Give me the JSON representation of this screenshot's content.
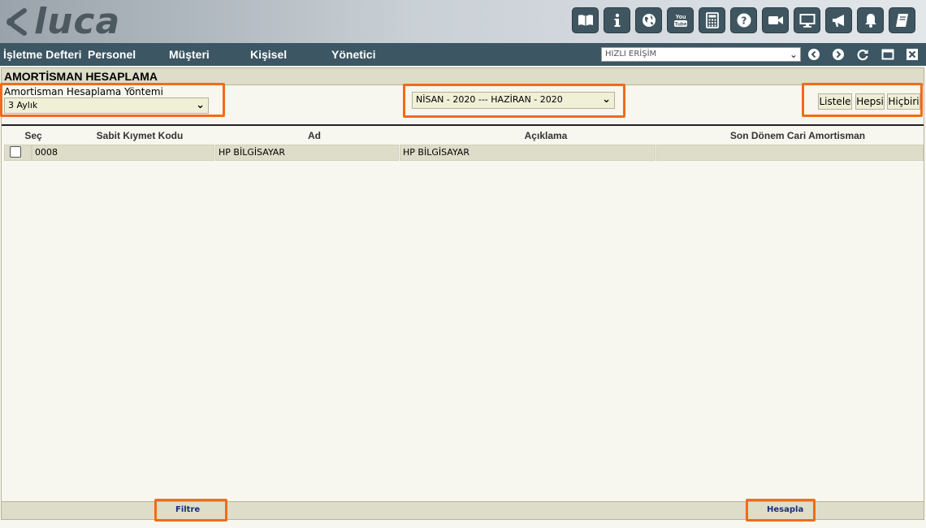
{
  "app": {
    "logo_text": "luca"
  },
  "header_icons": [
    {
      "name": "book-open-icon"
    },
    {
      "name": "info-icon"
    },
    {
      "name": "globe-icon"
    },
    {
      "name": "youtube-icon",
      "text": "You\nTube"
    },
    {
      "name": "calculator-icon"
    },
    {
      "name": "help-icon"
    },
    {
      "name": "video-camera-icon"
    },
    {
      "name": "monitor-icon"
    },
    {
      "name": "megaphone-icon"
    },
    {
      "name": "bell-icon"
    },
    {
      "name": "notebook-icon"
    }
  ],
  "nav": {
    "items": [
      "İşletme Defteri",
      "Personel",
      "Müşteri",
      "Kişisel",
      "Yönetici"
    ],
    "quick_access": "HIZLI ERİŞİM"
  },
  "panel": {
    "title": "AMORTİSMAN HESAPLAMA",
    "method_label": "Amortisman Hesaplama Yöntemi",
    "method_value": "3 Aylık",
    "period_value": "NİSAN - 2020 --- HAZİRAN - 2020",
    "buttons": {
      "list": "Listele",
      "all": "Hepsi",
      "none": "Hiçbiri"
    }
  },
  "table": {
    "headers": [
      "Seç",
      "Sabit Kıymet Kodu",
      "Ad",
      "Açıklama",
      "Son Dönem Cari Amortisman"
    ],
    "rows": [
      {
        "code": "0008",
        "name": "HP BİLGİSAYAR",
        "description": "HP BİLGİSAYAR",
        "amount": ""
      }
    ]
  },
  "footer": {
    "filter": "Filtre",
    "calculate": "Hesapla"
  },
  "colors": {
    "nav_bg": "#3c5663",
    "icon_bg": "#3f5661",
    "highlight": "#ef6c1a",
    "panel_bg": "#f7f7ef",
    "row_bg": "#ddddc9"
  }
}
